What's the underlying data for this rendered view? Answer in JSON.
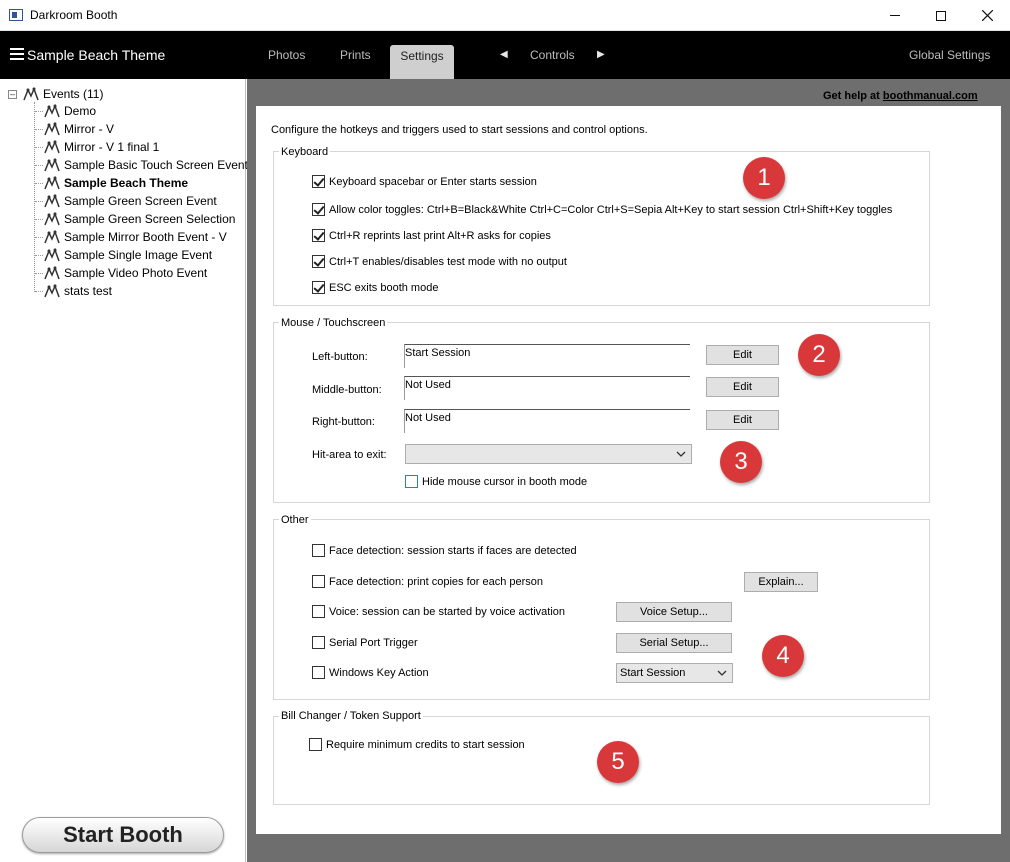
{
  "window": {
    "title": "Darkroom Booth"
  },
  "header": {
    "event_title": "Sample Beach Theme",
    "tabs": {
      "photos": "Photos",
      "prints": "Prints",
      "settings": "Settings",
      "controls": "Controls"
    },
    "global_settings": "Global Settings"
  },
  "sidebar": {
    "root_label": "Events (11)",
    "items": [
      "Demo",
      "Mirror - V",
      "Mirror - V  1 final  1",
      "Sample Basic Touch Screen Event",
      "Sample Beach Theme",
      "Sample Green Screen Event",
      "Sample Green Screen Selection",
      "Sample Mirror Booth Event - V",
      "Sample Single Image Event",
      "Sample Video Photo Event",
      "stats test"
    ],
    "selected_index": 4,
    "start_booth": "Start Booth"
  },
  "main": {
    "help_prefix": "Get help at ",
    "help_link": "boothmanual.com",
    "intro": "Configure the hotkeys and triggers used to start sessions and control options."
  },
  "keyboard": {
    "title": "Keyboard",
    "options": [
      {
        "label": "Keyboard spacebar or Enter starts session",
        "checked": true
      },
      {
        "label": "Allow color toggles:  Ctrl+B=Black&White   Ctrl+C=Color   Ctrl+S=Sepia   Alt+Key to start session   Ctrl+Shift+Key toggles",
        "checked": true
      },
      {
        "label": "Ctrl+R reprints last print   Alt+R asks for copies",
        "checked": true
      },
      {
        "label": "Ctrl+T enables/disables test mode with no output",
        "checked": true
      },
      {
        "label": "ESC exits booth mode",
        "checked": true
      }
    ]
  },
  "mouse": {
    "title": "Mouse / Touchscreen",
    "left_label": "Left-button:",
    "left_value": "Start Session",
    "middle_label": "Middle-button:",
    "middle_value": "Not Used",
    "right_label": "Right-button:",
    "right_value": "Not Used",
    "edit": "Edit",
    "hit_area_label": "Hit-area to exit:",
    "hit_area_value": "",
    "hide_cursor": "Hide mouse cursor in booth mode"
  },
  "other": {
    "title": "Other",
    "face_start": "Face detection: session starts if faces are detected",
    "face_print": "Face detection: print copies for each person",
    "explain": "Explain...",
    "voice": "Voice: session can be started by voice activation",
    "voice_setup": "Voice Setup...",
    "serial": "Serial Port Trigger",
    "serial_setup": "Serial Setup...",
    "windows_key": "Windows Key Action",
    "windows_key_value": "Start Session"
  },
  "bill": {
    "title": "Bill Changer / Token Support",
    "require": "Require minimum credits to start session"
  },
  "badges": [
    "1",
    "2",
    "3",
    "4",
    "5"
  ],
  "colors": {
    "accent_red": "#d9383a",
    "header_bg": "#000000",
    "panel_bg": "#6e6e6e"
  }
}
